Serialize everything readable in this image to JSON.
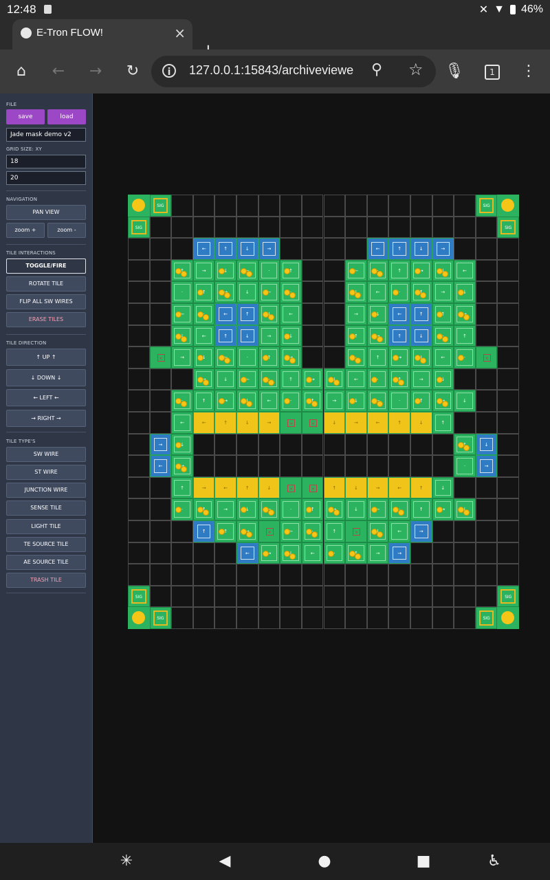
{
  "status": {
    "time": "12:48",
    "battery": "46%"
  },
  "browser": {
    "tab_title": "E-Tron FLOW!",
    "url": "127.0.0.1:15843/archiveviewe",
    "tab_count": "1"
  },
  "sidebar": {
    "file_label": "FILE",
    "save": "save",
    "load": "load",
    "project_name": "Jade mask demo v2",
    "grid_label": "GRID SIZE: XY",
    "grid_x": "18",
    "grid_y": "20",
    "nav_label": "NAVIGATION",
    "pan": "PAN VIEW",
    "zoom_in": "zoom +",
    "zoom_out": "zoom -",
    "inter_label": "TILE INTERACTIONS",
    "toggle": "TOGGLE/FIRE",
    "rotate": "ROTATE TILE",
    "flip": "FLIP ALL SW WIRES",
    "erase": "ERASE TILES",
    "dir_label": "TILE DIRECTION",
    "up": "↑ UP ↑",
    "down": "↓ DOWN ↓",
    "left": "← LEFT ←",
    "right": "→ RIGHT →",
    "types_label": "TILE TYPE'S",
    "sw": "SW WIRE",
    "st": "ST WIRE",
    "junction": "JUNCTION WIRE",
    "sense": "SENSE TILE",
    "light": "LIGHT TILE",
    "te": "TE SOURCE TILE",
    "ae": "AE SOURCE TILE",
    "trash": "TRASH TILE"
  },
  "grid": {
    "columns": 18,
    "rows": 20,
    "sig_label": "SIG",
    "rows_data": [
      "OS..............SO",
      "S................S",
      "...BBBB....BBBB...",
      "..GGGGGG..GGGGGG..",
      "..GGGGGG..GGGGGG..",
      "..GGBBGG..GGBBGG..",
      "..GGBBGG..GGBBGG..",
      ".XGGGGGG..GGGGGGX.",
      "...GGGGGGGGGGGG...",
      "..GGGGGGGGGGGGGG..",
      "..GYYYYXXYYYYYG...",
      ".BG............GB.",
      ".BG............GB.",
      "..GYYYYXXYYYYYG...",
      "..GGGGGGGGGGGGGG..",
      "...BGGXGGGXGGB....",
      ".....BGGGGGGB.....",
      "..................",
      "S................S",
      "OS..............SO"
    ]
  }
}
